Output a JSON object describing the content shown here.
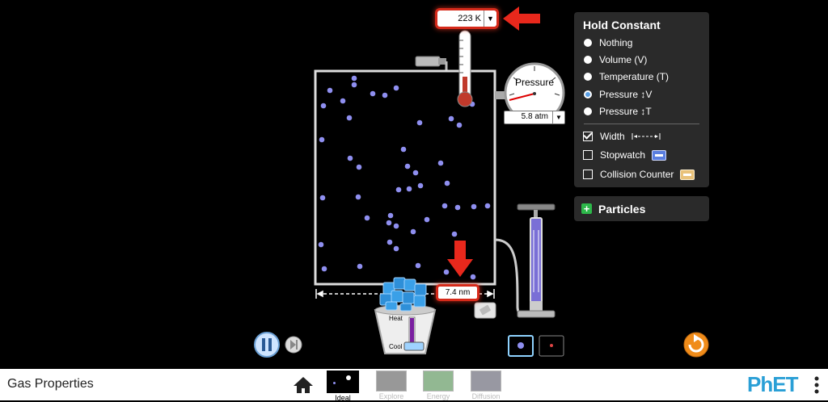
{
  "sim": {
    "temperature_value": "223 K",
    "pressure_label": "Pressure",
    "pressure_value": "5.8 atm",
    "width_value": "7.4 nm",
    "heat_label": "Heat",
    "cool_label": "Cool"
  },
  "hold_constant": {
    "title": "Hold Constant",
    "options": [
      "Nothing",
      "Volume (V)",
      "Temperature (T)",
      "Pressure ↕V",
      "Pressure ↕T"
    ],
    "selected": "Pressure ↕V"
  },
  "tools": {
    "width": "Width",
    "width_checked": true,
    "stopwatch": "Stopwatch",
    "stopwatch_checked": false,
    "collision_counter": "Collision Counter",
    "collision_counter_checked": false
  },
  "particles_panel": {
    "title": "Particles"
  },
  "nav": {
    "app_title": "Gas Properties",
    "screens": [
      "Ideal",
      "Explore",
      "Energy",
      "Diffusion"
    ],
    "active_screen": "Ideal",
    "brand": "PhET"
  },
  "colors": {
    "highlight_red": "#e8281c",
    "particle": "#8f8ff0",
    "panel": "#2a2a2a",
    "radio_selected": "#5aa0e6",
    "reset_orange": "#f08c1a"
  }
}
